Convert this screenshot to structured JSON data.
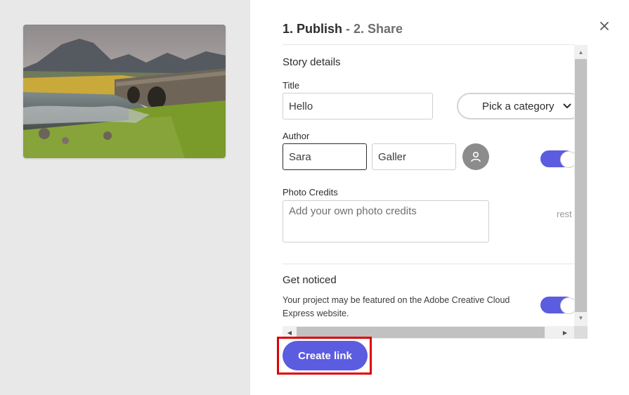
{
  "dialog": {
    "heading_step1": "1. Publish",
    "heading_sep": " - ",
    "heading_step2": "2. Share",
    "close_icon": "close-icon"
  },
  "story_details": {
    "section_title": "Story details",
    "title_label": "Title",
    "title_value": "Hello",
    "category_label": "Pick a category",
    "author_label": "Author",
    "author_first": "Sara",
    "author_last": "Galler",
    "avatar_icon": "user-icon",
    "photo_credits_label": "Photo Credits",
    "photo_credits_placeholder": "Add your own photo credits",
    "rest_text": "rest"
  },
  "get_noticed": {
    "section_title": "Get noticed",
    "description": "Your project may be featured on the Adobe Creative Cloud Express website."
  },
  "actions": {
    "create_link_label": "Create link"
  },
  "colors": {
    "accent": "#5c5ce0",
    "highlight": "#e00000",
    "left_pane": "#e8e8e8"
  }
}
